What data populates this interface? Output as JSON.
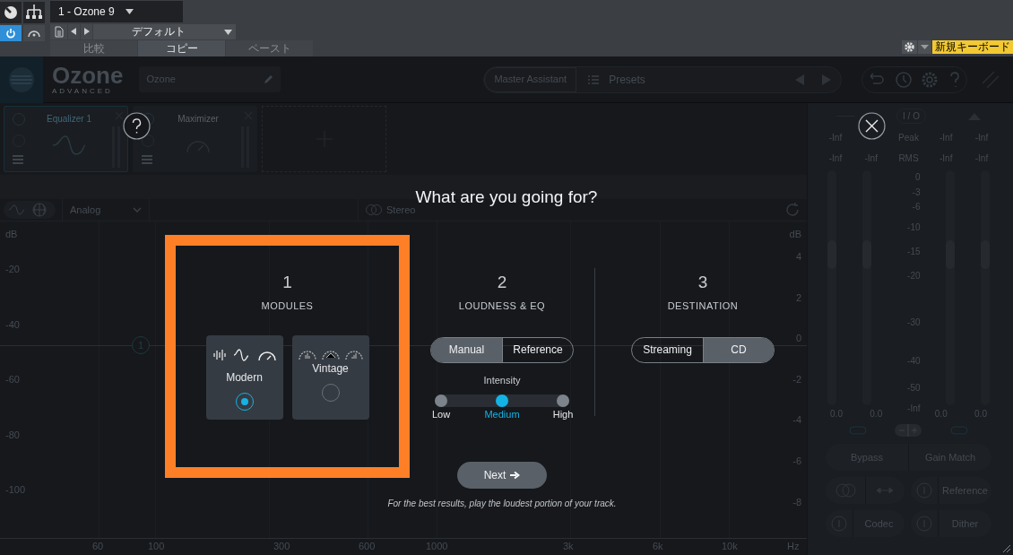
{
  "host": {
    "track_tab": "1 - Ozone 9",
    "power_on": true,
    "preset": "デフォルト",
    "actions": [
      {
        "label": "比較",
        "selected": false
      },
      {
        "label": "コピー",
        "selected": true
      },
      {
        "label": "ペースト",
        "selected": false
      }
    ],
    "keyboard_button": "新規キーボード"
  },
  "plugin": {
    "logo": "Ozone",
    "edition": "ADVANCED",
    "preset_name": "Ozone",
    "assistant_button": "Master Assistant",
    "presets_label": "Presets"
  },
  "modules": [
    {
      "name": "Equalizer 1",
      "selected": true
    },
    {
      "name": "Maximizer",
      "selected": false
    }
  ],
  "eq": {
    "mode": "Analog",
    "stereo": "Stereo",
    "node": "1",
    "left_ticks": [
      "dB",
      "-20",
      "-40",
      "-60",
      "-80",
      "-100"
    ],
    "right_ticks": [
      "dB",
      "4",
      "2",
      "0",
      "-2",
      "-4",
      "-6",
      "-8"
    ],
    "freq_ticks": [
      "60",
      "100",
      "300",
      "600",
      "1000",
      "3k",
      "6k",
      "10k",
      "Hz"
    ]
  },
  "meters": {
    "io_label": "I / O",
    "peak_label": "Peak",
    "rms_label": "RMS",
    "peak_values": [
      "-Inf",
      "-Inf",
      "-Inf"
    ],
    "rms_values": [
      "-Inf",
      "-Inf",
      "-Inf",
      "-Inf"
    ],
    "scale": [
      "0",
      "-3",
      "-6",
      "-10",
      "-15",
      "-20",
      "-30",
      "-40",
      "-50",
      "-Inf"
    ],
    "gains": [
      "0.0",
      "0.0",
      "0.0",
      "0.0"
    ],
    "bypass": "Bypass",
    "gain_match": "Gain Match",
    "reference": "Reference",
    "codec": "Codec",
    "dither": "Dither"
  },
  "assistant": {
    "title": "What are you going for?",
    "steps": [
      {
        "number": "1",
        "label": "MODULES"
      },
      {
        "number": "2",
        "label": "LOUDNESS & EQ"
      },
      {
        "number": "3",
        "label": "DESTINATION"
      }
    ],
    "module_options": [
      {
        "label": "Modern",
        "selected": true
      },
      {
        "label": "Vintage",
        "selected": false
      }
    ],
    "loudness_modes": [
      {
        "label": "Manual",
        "selected": true
      },
      {
        "label": "Reference",
        "selected": false
      }
    ],
    "intensity_label": "Intensity",
    "intensity": [
      {
        "label": "Low",
        "selected": false
      },
      {
        "label": "Medium",
        "selected": true
      },
      {
        "label": "High",
        "selected": false
      }
    ],
    "destinations": [
      {
        "label": "Streaming",
        "selected": false
      },
      {
        "label": "CD",
        "selected": true
      }
    ],
    "next_button": "Next",
    "hint": "For the best results, play the loudest portion of your track."
  }
}
